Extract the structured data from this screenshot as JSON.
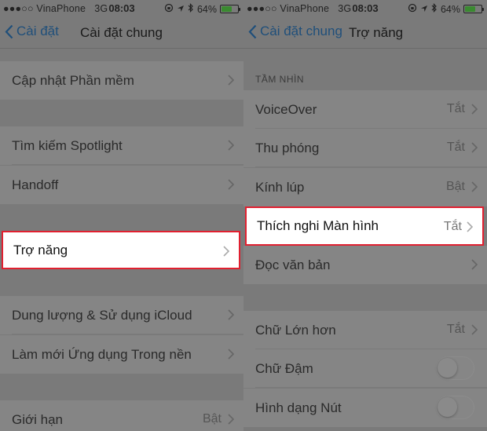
{
  "status": {
    "carrier": "●●●○○ VinaPhone",
    "network": "3G",
    "time": "08:03",
    "battery": "64%",
    "battery_level": 0.64
  },
  "left": {
    "back_label": "Cài đặt",
    "title": "Cài đặt chung",
    "items": [
      {
        "label": "Cập nhật Phần mềm",
        "value": ""
      },
      {
        "label": "Tìm kiếm Spotlight",
        "value": ""
      },
      {
        "label": "Handoff",
        "value": ""
      },
      {
        "label": "Trợ năng",
        "value": ""
      },
      {
        "label": "Dung lượng & Sử dụng iCloud",
        "value": ""
      },
      {
        "label": "Làm mới Ứng dụng Trong nền",
        "value": ""
      },
      {
        "label": "Giới hạn",
        "value": "Bật"
      }
    ]
  },
  "right": {
    "back_label": "Cài đặt chung",
    "title": "Trợ năng",
    "section_vision": "TẦM NHÌN",
    "items": [
      {
        "label": "VoiceOver",
        "value": "Tắt"
      },
      {
        "label": "Thu phóng",
        "value": "Tắt"
      },
      {
        "label": "Kính lúp",
        "value": "Bật"
      },
      {
        "label": "Thích nghi Màn hình",
        "value": "Tắt"
      },
      {
        "label": "Đọc văn bản",
        "value": ""
      },
      {
        "label": "Chữ Lớn hơn",
        "value": "Tắt"
      },
      {
        "label": "Chữ Đậm",
        "value": ""
      },
      {
        "label": "Hình dạng Nút",
        "value": ""
      }
    ],
    "toggles": {
      "bold_text": false,
      "button_shapes": false
    }
  }
}
